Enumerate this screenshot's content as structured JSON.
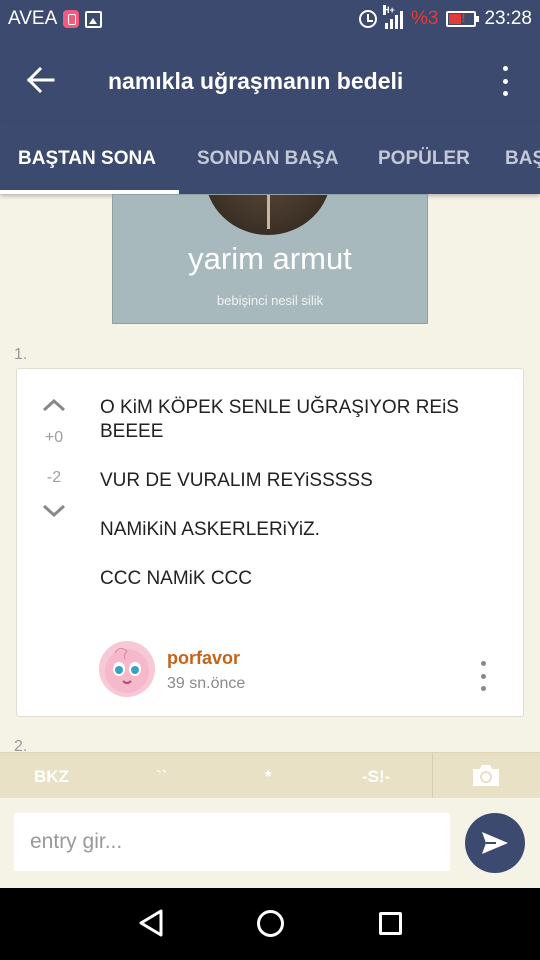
{
  "status_bar": {
    "carrier": "AVEA",
    "network": "H+",
    "battery_percent": "%3",
    "time": "23:28"
  },
  "app_bar": {
    "title": "namıkla uğraşmanın bedeli"
  },
  "tabs": [
    {
      "label": "BAŞTAN SONA",
      "active": true
    },
    {
      "label": "SONDAN BAŞA",
      "active": false
    },
    {
      "label": "POPÜLER",
      "active": false
    },
    {
      "label": "BAŞ",
      "active": false
    }
  ],
  "banner": {
    "title": "yarim armut",
    "subtitle": "bebişinci nesil silik"
  },
  "entries": [
    {
      "number": "1.",
      "score_plus": "+0",
      "score_minus": "-2",
      "paragraphs": [
        "O KiM KÖPEK SENLE UĞRAŞIYOR REiS BEEEE",
        "VUR DE VURALIM REYiSSSSS",
        "NAMiKiN ASKERLERiYiZ.",
        "CCC NAMiK CCC"
      ],
      "author": "porfavor",
      "time": "39 sn.önce"
    }
  ],
  "next_entry_number": "2.",
  "helper_bar": {
    "bkz": "BKZ",
    "backtick": "``",
    "star": "*",
    "spoiler": "-S!-"
  },
  "input": {
    "placeholder": "entry gir..."
  },
  "colors": {
    "primary": "#3b4a6e",
    "background": "#f5f2e6",
    "author": "#c56419",
    "helper_bar": "#e8e1c6"
  }
}
